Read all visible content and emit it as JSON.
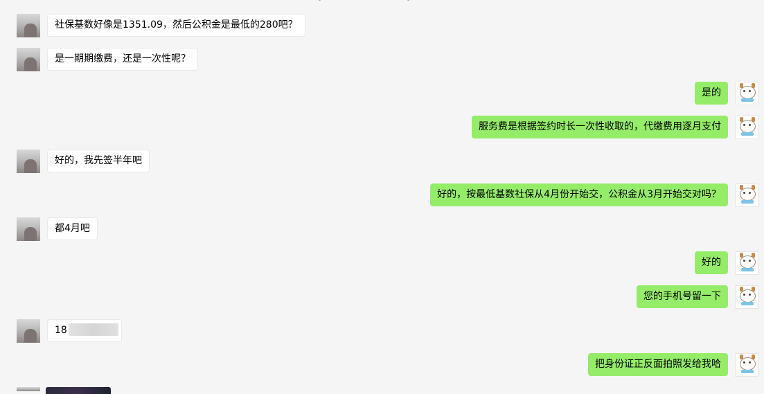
{
  "chat": {
    "messages": [
      {
        "side": "left",
        "text": "社保基数好像是1351.09，然后公积金是最低的280吧？"
      },
      {
        "side": "left",
        "text": "是一期期缴费，还是一次性呢？"
      },
      {
        "side": "right",
        "text": "是的"
      },
      {
        "side": "right",
        "text": "服务费是根据签约时长一次性收取的，代缴费用逐月支付"
      },
      {
        "side": "left",
        "text": "好的，我先签半年吧"
      },
      {
        "side": "right",
        "text": "好的，按最低基数社保从4月份开始交，公积金从3月开始交对吗？"
      },
      {
        "side": "left",
        "text": "都4月吧"
      },
      {
        "side": "right",
        "text": "好的"
      },
      {
        "side": "right",
        "text": "您的手机号留一下"
      },
      {
        "side": "left",
        "text": "18"
      },
      {
        "side": "right",
        "text": "把身份证正反面拍照发给我哈"
      }
    ]
  },
  "colors": {
    "background": "#f5f5f5",
    "incoming_bubble": "#ffffff",
    "outgoing_bubble": "#95ec69"
  },
  "icons": {
    "left_avatar": "contact-avatar-icon",
    "right_avatar": "cartoon-avatar-icon"
  }
}
